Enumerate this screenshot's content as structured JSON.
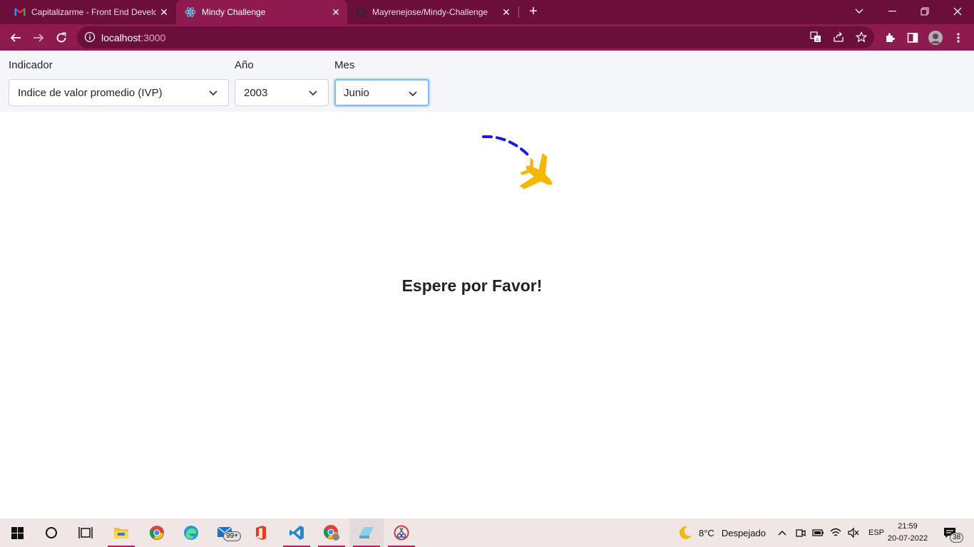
{
  "browser": {
    "tabs": [
      {
        "title": "Capitalizarme - Front End Develo",
        "active": false
      },
      {
        "title": "Mindy Challenge",
        "active": true
      },
      {
        "title": "Mayrenejose/Mindy-Challenge",
        "active": false
      }
    ],
    "url_host": "localhost",
    "url_port": ":3000"
  },
  "filters": {
    "indicador": {
      "label": "Indicador",
      "value": "Indice de valor promedio (IVP)"
    },
    "anio": {
      "label": "Año",
      "value": "2003"
    },
    "mes": {
      "label": "Mes",
      "value": "Junio"
    }
  },
  "loading": {
    "message": "Espere por Favor!",
    "accent_plane": "#f5b800",
    "accent_trail": "#1a1ae6"
  },
  "taskbar": {
    "mail_badge": "99+",
    "weather_temp": "8°C",
    "weather_text": "Despejado",
    "language": "ESP",
    "time": "21:59",
    "date": "20-07-2022",
    "notifications": "38"
  },
  "colors": {
    "tabbar": "#6b0f3a",
    "toolbar": "#8e1a4f",
    "filter_bg": "#f4f6f9"
  }
}
